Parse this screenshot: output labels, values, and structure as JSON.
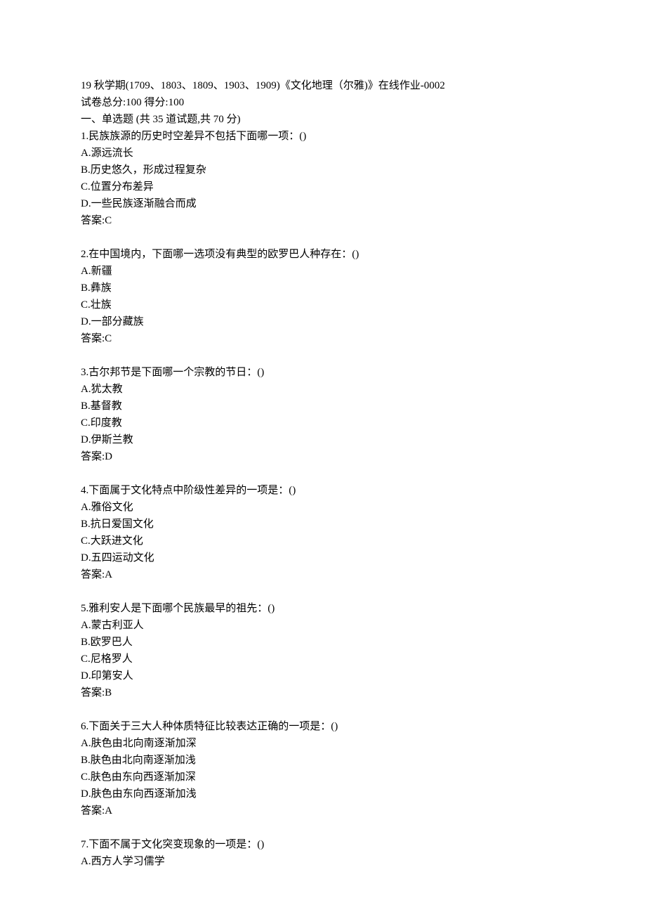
{
  "header": {
    "title": "19 秋学期(1709、1803、1809、1903、1909)《文化地理（尔雅)》在线作业-0002",
    "score_line": "试卷总分:100  得分:100"
  },
  "section": {
    "title": "一、单选题 (共 35 道试题,共 70 分)"
  },
  "questions": [
    {
      "q": "1.民族族源的历史时空差异不包括下面哪一项：()",
      "a": "A.源远流长",
      "b": "B.历史悠久，形成过程复杂",
      "c": "C.位置分布差异",
      "d": "D.一些民族逐渐融合而成",
      "ans": "答案:C"
    },
    {
      "q": "2.在中国境内，下面哪一选项没有典型的欧罗巴人种存在：()",
      "a": "A.新疆",
      "b": "B.彝族",
      "c": "C.壮族",
      "d": "D.一部分藏族",
      "ans": "答案:C"
    },
    {
      "q": "3.古尔邦节是下面哪一个宗教的节日：()",
      "a": "A.犹太教",
      "b": "B.基督教",
      "c": "C.印度教",
      "d": "D.伊斯兰教",
      "ans": "答案:D"
    },
    {
      "q": "4.下面属于文化特点中阶级性差异的一项是：()",
      "a": "A.雅俗文化",
      "b": "B.抗日爱国文化",
      "c": "C.大跃进文化",
      "d": "D.五四运动文化",
      "ans": "答案:A"
    },
    {
      "q": "5.雅利安人是下面哪个民族最早的祖先：()",
      "a": "A.蒙古利亚人",
      "b": "B.欧罗巴人",
      "c": "C.尼格罗人",
      "d": "D.印第安人",
      "ans": "答案:B"
    },
    {
      "q": "6.下面关于三大人种体质特征比较表达正确的一项是：()",
      "a": "A.肤色由北向南逐渐加深",
      "b": "B.肤色由北向南逐渐加浅",
      "c": "C.肤色由东向西逐渐加深",
      "d": "D.肤色由东向西逐渐加浅",
      "ans": "答案:A"
    },
    {
      "q": "7.下面不属于文化突变现象的一项是：()",
      "a": "A.西方人学习儒学",
      "b": "",
      "c": "",
      "d": "",
      "ans": ""
    }
  ]
}
